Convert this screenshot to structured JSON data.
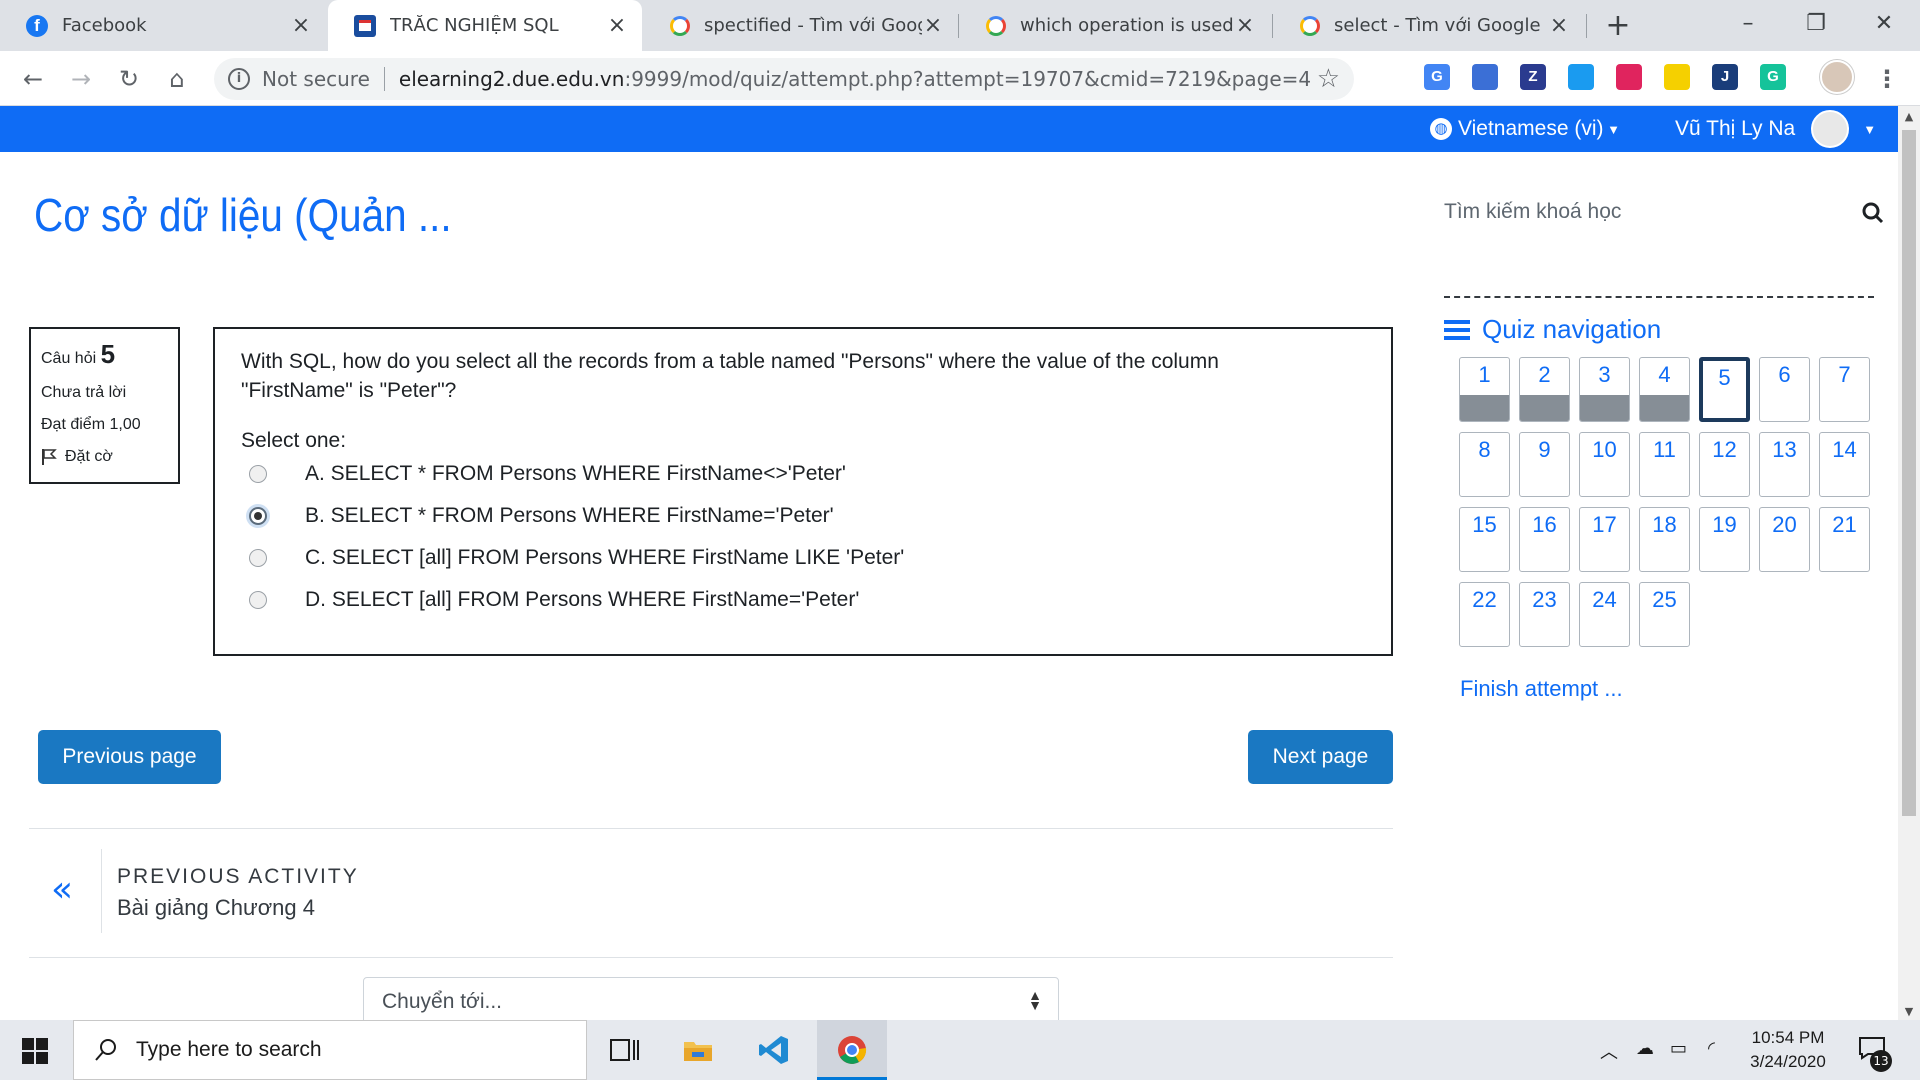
{
  "browser": {
    "tabs": [
      {
        "title": "Facebook",
        "icon": "facebook-icon",
        "active": false
      },
      {
        "title": "TRẮC NGHIỆM SQL",
        "icon": "sql-site-icon",
        "active": true
      },
      {
        "title": "spectified - Tìm với Google",
        "icon": "google-icon",
        "active": false
      },
      {
        "title": "which operation is used to",
        "icon": "google-icon",
        "active": false
      },
      {
        "title": "select - Tìm với Google",
        "icon": "google-icon",
        "active": false
      }
    ],
    "new_tab": "+",
    "address": {
      "security": "Not secure",
      "host": "elearning2.due.edu.vn",
      "path": ":9999/mod/quiz/attempt.php?attempt=19707&cmid=7219&page=4"
    },
    "extensions": [
      {
        "name": "camera-icon",
        "label": "",
        "color": "#5f6368"
      },
      {
        "name": "translate-icon",
        "label": "G",
        "color": "#4285f4"
      },
      {
        "name": "extension-spinner-icon",
        "label": "",
        "color": "#3b6fd6"
      },
      {
        "name": "zotero-icon",
        "label": "Z",
        "color": "#2a3b8f"
      },
      {
        "name": "drop-icon",
        "label": "",
        "color": "#1a9bf0"
      },
      {
        "name": "color-icon",
        "label": "",
        "color": "#e0245e"
      },
      {
        "name": "highlight-icon",
        "label": "",
        "color": "#f5d000"
      },
      {
        "name": "jump-icon",
        "label": "J",
        "color": "#1a3d7a"
      },
      {
        "name": "grammarly-icon",
        "label": "G",
        "color": "#15c39a"
      }
    ]
  },
  "navbar": {
    "language": "Vietnamese (vi)",
    "user": "Vũ Thị Ly Na",
    "accent": "#0f6cf5"
  },
  "course_title": "Cơ sở dữ liệu (Quản ...",
  "search": {
    "placeholder": "Tìm kiếm khoá học"
  },
  "question_info": {
    "label": "Câu hỏi",
    "number": "5",
    "status": "Chưa trả lời",
    "points": "Đạt điểm 1,00",
    "flag": "Đặt cờ"
  },
  "question": {
    "text": "With SQL, how do you select all the records from a table named \"Persons\" where the value of the column \"FirstName\" is \"Peter\"?",
    "prompt": "Select one:",
    "answers": [
      {
        "label": "A. SELECT * FROM Persons WHERE FirstName<>'Peter'",
        "selected": false
      },
      {
        "label": "B. SELECT * FROM Persons WHERE FirstName='Peter'",
        "selected": true
      },
      {
        "label": "C. SELECT [all] FROM Persons WHERE FirstName LIKE 'Peter'",
        "selected": false
      },
      {
        "label": "D. SELECT [all] FROM Persons WHERE FirstName='Peter'",
        "selected": false
      }
    ]
  },
  "buttons": {
    "previous": "Previous page",
    "next": "Next page"
  },
  "activity_nav": {
    "label": "PREVIOUS ACTIVITY",
    "name": "Bài giảng Chương 4"
  },
  "jump_menu": {
    "selected": "Chuyển tới..."
  },
  "quiz_nav": {
    "title": "Quiz navigation",
    "current": 5,
    "questions": [
      {
        "n": "1",
        "state": "answered"
      },
      {
        "n": "2",
        "state": "answered"
      },
      {
        "n": "3",
        "state": "answered"
      },
      {
        "n": "4",
        "state": "answered"
      },
      {
        "n": "5",
        "state": "current"
      },
      {
        "n": "6",
        "state": "none"
      },
      {
        "n": "7",
        "state": "none"
      },
      {
        "n": "8",
        "state": "none"
      },
      {
        "n": "9",
        "state": "none"
      },
      {
        "n": "10",
        "state": "none"
      },
      {
        "n": "11",
        "state": "none"
      },
      {
        "n": "12",
        "state": "none"
      },
      {
        "n": "13",
        "state": "none"
      },
      {
        "n": "14",
        "state": "none"
      },
      {
        "n": "15",
        "state": "none"
      },
      {
        "n": "16",
        "state": "none"
      },
      {
        "n": "17",
        "state": "none"
      },
      {
        "n": "18",
        "state": "none"
      },
      {
        "n": "19",
        "state": "none"
      },
      {
        "n": "20",
        "state": "none"
      },
      {
        "n": "21",
        "state": "none"
      },
      {
        "n": "22",
        "state": "none"
      },
      {
        "n": "23",
        "state": "none"
      },
      {
        "n": "24",
        "state": "none"
      },
      {
        "n": "25",
        "state": "none"
      }
    ],
    "finish": "Finish attempt ..."
  },
  "taskbar": {
    "search_placeholder": "Type here to search",
    "time": "10:54 PM",
    "date": "3/24/2020",
    "notifications": "13"
  }
}
